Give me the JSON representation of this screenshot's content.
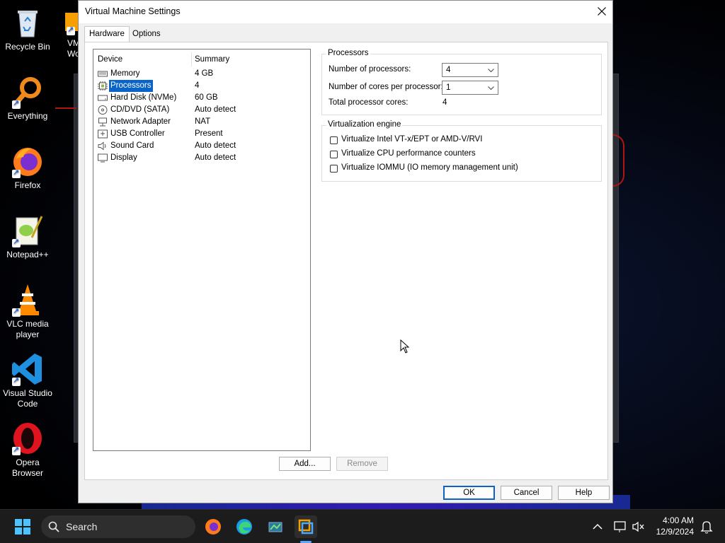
{
  "desktop": {
    "icons": [
      {
        "label": "Recycle Bin"
      },
      {
        "label": "Everything"
      },
      {
        "label": "Firefox"
      },
      {
        "label": "Notepad++"
      },
      {
        "label": "VLC media player"
      },
      {
        "label": "Visual Studio Code"
      },
      {
        "label": "Opera Browser"
      },
      {
        "label": "VM Wor"
      }
    ]
  },
  "dialog": {
    "title": "Virtual Machine Settings",
    "tabs": [
      {
        "label": "Hardware"
      },
      {
        "label": "Options"
      }
    ],
    "active_tab": "Hardware",
    "device_list": {
      "headers": {
        "device": "Device",
        "summary": "Summary"
      },
      "rows": [
        {
          "device": "Memory",
          "summary": "4 GB",
          "icon": "memory-icon"
        },
        {
          "device": "Processors",
          "summary": "4",
          "icon": "processor-icon"
        },
        {
          "device": "Hard Disk (NVMe)",
          "summary": "60 GB",
          "icon": "hard-disk-icon"
        },
        {
          "device": "CD/DVD (SATA)",
          "summary": "Auto detect",
          "icon": "cd-dvd-icon"
        },
        {
          "device": "Network Adapter",
          "summary": "NAT",
          "icon": "network-adapter-icon"
        },
        {
          "device": "USB Controller",
          "summary": "Present",
          "icon": "usb-controller-icon"
        },
        {
          "device": "Sound Card",
          "summary": "Auto detect",
          "icon": "sound-card-icon"
        },
        {
          "device": "Display",
          "summary": "Auto detect",
          "icon": "display-icon"
        }
      ],
      "selected": "Processors"
    },
    "add_button": "Add...",
    "remove_button": "Remove",
    "processors_group": {
      "title": "Processors",
      "num_processors_label": "Number of processors:",
      "num_processors_value": "4",
      "cores_label": "Number of cores per processor:",
      "cores_value": "1",
      "total_label": "Total processor cores:",
      "total_value": "4"
    },
    "virtualization_group": {
      "title": "Virtualization engine",
      "options": [
        {
          "label": "Virtualize Intel VT-x/EPT or AMD-V/RVI",
          "checked": false
        },
        {
          "label": "Virtualize CPU performance counters",
          "checked": false
        },
        {
          "label": "Virtualize IOMMU (IO memory management unit)",
          "checked": false
        }
      ]
    },
    "ok_button": "OK",
    "cancel_button": "Cancel",
    "help_button": "Help"
  },
  "taskbar": {
    "search_label": "Search",
    "time": "4:00 AM",
    "date": "12/9/2024"
  },
  "colors": {
    "selection": "#0a64c8",
    "taskbar": "#1c1c1c",
    "dialog_bg": "#f0f0f0"
  }
}
